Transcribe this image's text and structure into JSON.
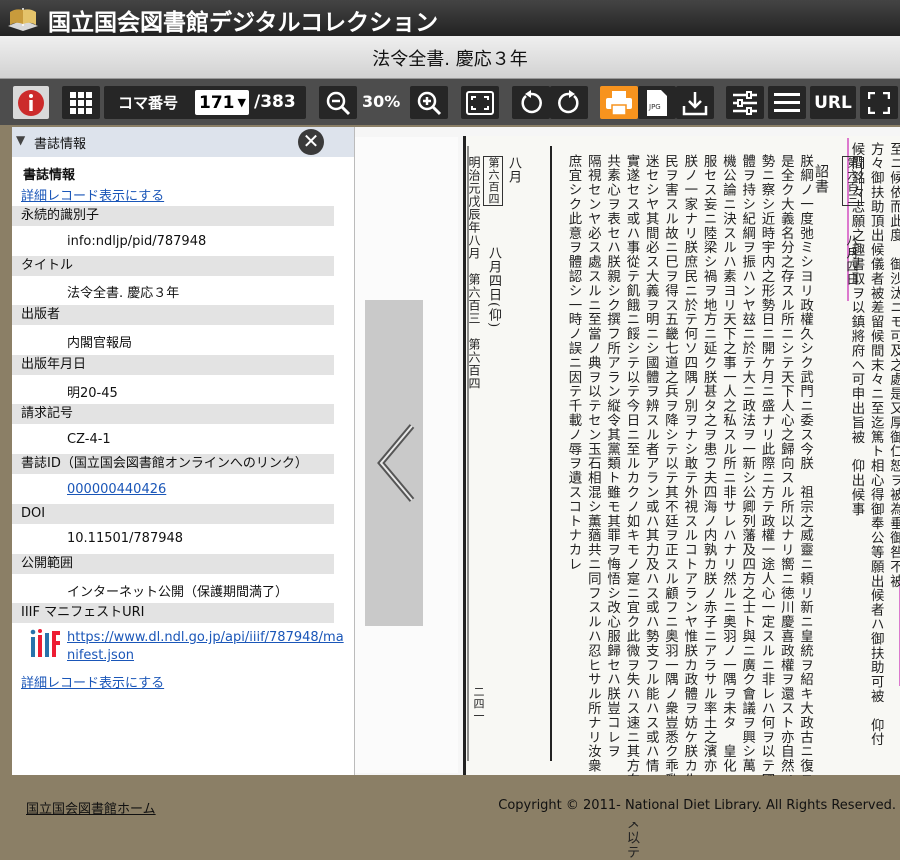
{
  "header": {
    "site_title": "国立国会図書館デジタルコレクション"
  },
  "book_title": "法令全書. 慶応３年",
  "toolbar": {
    "koma_label": "コマ番号",
    "page_value": "171",
    "page_total": "/383",
    "zoom_level": "30%",
    "url_label": "URL"
  },
  "panel": {
    "header_label": "書誌情報",
    "section_title": "書誌情報",
    "detail_link": "詳細レコード表示にする",
    "fields": [
      {
        "label": "永続的識別子",
        "value": "info:ndljp/pid/787948"
      },
      {
        "label": "タイトル",
        "value": "法令全書. 慶応３年"
      },
      {
        "label": "出版者",
        "value": "内閣官報局"
      },
      {
        "label": "出版年月日",
        "value": "明20-45"
      },
      {
        "label": "請求記号",
        "value": "CZ-4-1"
      },
      {
        "label": "書誌ID（国立国会図書館オンラインへのリンク）",
        "value": "000000440426"
      },
      {
        "label": "DOI",
        "value": "10.11501/787948"
      },
      {
        "label": "公開範囲",
        "value": "インターネット公開（保護期間満了）"
      },
      {
        "label": "IIIF マニフェストURI",
        "value_line1": "https://www.dl.ndl.go.jp/api/iiif/787948/ma",
        "value_line2": "nifest.json"
      }
    ],
    "detail_link_bottom": "詳細レコード表示にする"
  },
  "scan_text": {
    "side_header": "明治元戊辰年八月　第六百三　第六百四",
    "page_number": "二四一",
    "headings": [
      "第六百三",
      "八月四日",
      "第六百四",
      "八月",
      "八月四日(仰)",
      "詔書"
    ],
    "columns": [
      "至ニ候依而此度　御沙汰ニモ可及之處是又厚御仁恕ヲ被為垂御咎不被",
      "方々御扶助頂出候儀者被差留候間末々ニ至迄篤ト相心得御奉公等願出候者ハ御扶助可被　仰付",
      "候間銘々志願之趣書取ヲ以鎮將府ヘ可申出旨被　仰出候事",
      "朕綱ノ一度弛ミシヨリ政權久シク武門ニ委ス今朕　祖宗之威靈ニ頼リ新ニ皇統ヲ紹キ大政古ニ復ス",
      "是全ク大義名分之存スル所ニシテ天下人心之歸向スル所以ナリ嚮ニ徳川慶喜政權ヲ還スト亦自然ノ",
      "勢ニ察シ近時宇内之形勢日ニ開ケ月ニ盛ナリ此際ニ方テ政權一途人心一定スルニ非レハ何ヲ以テ國",
      "體ヲ持シ紀綱ヲ振ハンヤ玆ニ於テ大ニ政法ヲ一新シ公卿列藩及四方之士ト與ニ廣ク會議ヲ興シ萬",
      "機公論ニ決スルハ素ヨリ天下之事一人之私スル所ニ非サレハナリ然ルニ奥羽ノ一隅ヲ未タ　皇化ニ",
      "服セス妄ニ陸梁シ禍ヲ地方ニ延ク朕甚タ之ヲ患フ夫四海ノ内孰カ朕ノ赤子ニアラサル率土之濱亦",
      "朕ノ一家ナリ朕庶民ニ於テ何ソ四隅ノ別ヲナシ敢テ外視スルコトアランヤ惟朕カ政體ヲ妨ケ朕カ生",
      "民ヲ害スル故ニ巳ヲ得ス五畿七道之兵ヲ降シテ以テ其不廷ヲ正スル顧フニ奥羽一隅ノ衆豈悉ク乖亂昏",
      "迷セシヤ其間必ス大義ヲ明ニシ國體ヲ辨スル者アラン或ハ其力及ハス或ハ勢支フル能ハス或ハ情",
      "實遂セス或ハ事從テ飢餓ニ餒シテ以テ今日ニ至ルカクノ如キモノ寔ニ宜ク此微ヲ失ハス速ニ其方向ヲ定メ以テ",
      "共素心ヲ表セハ朕親シク撰フ所アラン縦令其黨類ト雖モ其罪ヲ悔悟シ改心服歸セハ朕豈コレヲ",
      "隔視センヤ必ス處スルニ至當ノ典ヲ以テセン玉石相混シ薫蕕共ニ同フスルハ忍ヒサル所ナリ汝衆",
      "庶宜シク此意ヲ體認シ一時ノ誤ニ因テ千載ノ辱ヲ遺スコトナカレ"
    ]
  },
  "footer": {
    "home_link": "国立国会図書館ホーム",
    "copyright": "Copyright © 2011- National Diet Library. All Rights Reserved."
  },
  "colors": {
    "accent_orange": "#f7931e",
    "info_red": "#cc2b2b",
    "link_blue": "#1a56b8"
  }
}
